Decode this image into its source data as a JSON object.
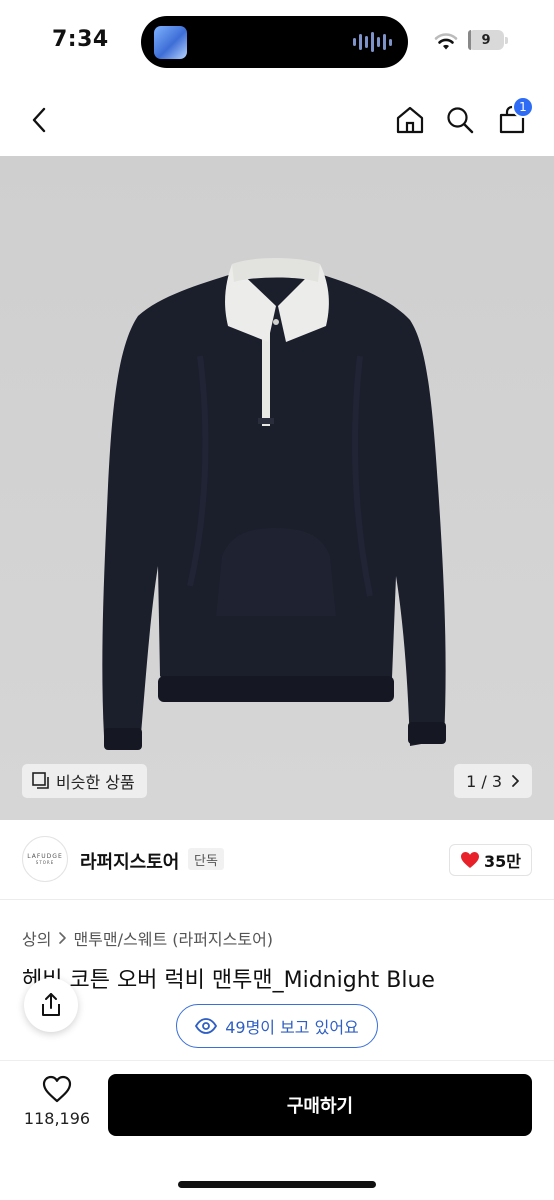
{
  "status_bar": {
    "time": "7:34",
    "battery": "9"
  },
  "nav": {
    "cart_badge": "1",
    "icons": [
      "chevron-left-icon",
      "home-icon",
      "search-icon",
      "cart-icon"
    ]
  },
  "image": {
    "similar_label": "비슷한 상품",
    "page_indicator": "1 / 3",
    "background_color": "#d2d2d2"
  },
  "seller": {
    "logo_text": "LAFUDGE",
    "logo_subtext": "STORE",
    "name": "라퍼지스토어",
    "badge": "단독",
    "likes": "35만"
  },
  "product": {
    "breadcrumb": [
      "상의",
      "맨투맨/스웨트 (라퍼지스토어)"
    ],
    "title": "헤비 코튼 오버 럭비 맨투맨_Midnight Blue",
    "viewers": "49명이 보고 있어요"
  },
  "bottom_bar": {
    "wish_count": "118,196",
    "buy_label": "구매하기"
  },
  "colors": {
    "accent": "#2f6cf6",
    "viewers_border": "#3a6fd8",
    "heart": "#e8202a",
    "buy_button": "#000000"
  }
}
